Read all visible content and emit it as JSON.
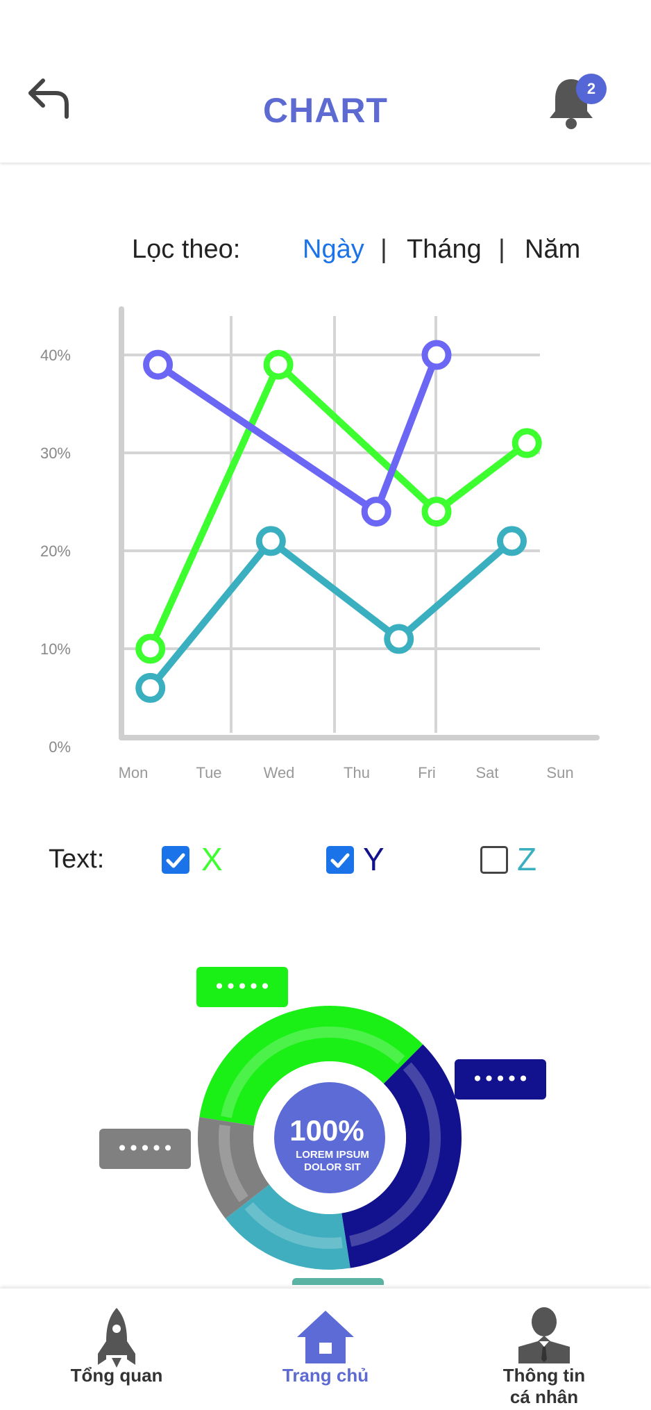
{
  "header": {
    "title": "CHART",
    "notification_count": "2",
    "back_icon": "back-arrow-icon",
    "bell_icon": "bell-icon"
  },
  "filter": {
    "label": "Lọc theo:",
    "options": [
      "Ngày",
      "Tháng",
      "Năm"
    ],
    "active_index": 0,
    "separator": "|",
    "active_color": "#1a73e8"
  },
  "chart_data": {
    "type": "line",
    "categories": [
      "Mon",
      "Tue",
      "Wed",
      "Thu",
      "Fri",
      "Sat",
      "Sun"
    ],
    "y_ticks": [
      "0%",
      "10%",
      "20%",
      "30%",
      "40%"
    ],
    "ylim": [
      0,
      40
    ],
    "grid": true,
    "series": [
      {
        "name": "X",
        "color": "#3dff2f",
        "points": [
          {
            "x": 0.2,
            "y": 10
          },
          {
            "x": 1.9,
            "y": 39
          },
          {
            "x": 4.0,
            "y": 24
          },
          {
            "x": 5.2,
            "y": 31
          }
        ]
      },
      {
        "name": "Y",
        "color": "#6b66f4",
        "points": [
          {
            "x": 0.3,
            "y": 39
          },
          {
            "x": 3.2,
            "y": 24
          },
          {
            "x": 4.0,
            "y": 40
          }
        ]
      },
      {
        "name": "Z",
        "color": "#3aafc0",
        "points": [
          {
            "x": 0.2,
            "y": 6
          },
          {
            "x": 1.8,
            "y": 21
          },
          {
            "x": 3.5,
            "y": 11
          },
          {
            "x": 5.0,
            "y": 21
          }
        ]
      }
    ]
  },
  "legend": {
    "label": "Text:",
    "items": [
      {
        "name": "X",
        "checked": true,
        "color": "#3dff2f"
      },
      {
        "name": "Y",
        "checked": true,
        "color": "#12128f"
      },
      {
        "name": "Z",
        "checked": false,
        "color": "#3aafc0"
      }
    ]
  },
  "donut": {
    "center_value": "100%",
    "center_line1": "LOREM IPSUM",
    "center_line2": "DOLOR SIT",
    "segments": [
      {
        "color": "#1aef16",
        "fraction": 0.35
      },
      {
        "color": "#12128f",
        "fraction": 0.35
      },
      {
        "color": "#40aebf",
        "fraction": 0.17
      },
      {
        "color": "#808080",
        "fraction": 0.13
      }
    ],
    "tags": [
      {
        "text": "•••••",
        "color": "#1aef16"
      },
      {
        "text": "•••••",
        "color": "#12128f"
      },
      {
        "text": "•••••",
        "color": "#808080"
      }
    ]
  },
  "nav": {
    "items": [
      {
        "label": "Tổng quan",
        "icon": "rocket-icon",
        "active": false
      },
      {
        "label": "Trang chủ",
        "icon": "home-icon",
        "active": true
      },
      {
        "label_line1": "Thông tin",
        "label_line2": "cá nhân",
        "icon": "person-icon",
        "active": false
      }
    ]
  }
}
